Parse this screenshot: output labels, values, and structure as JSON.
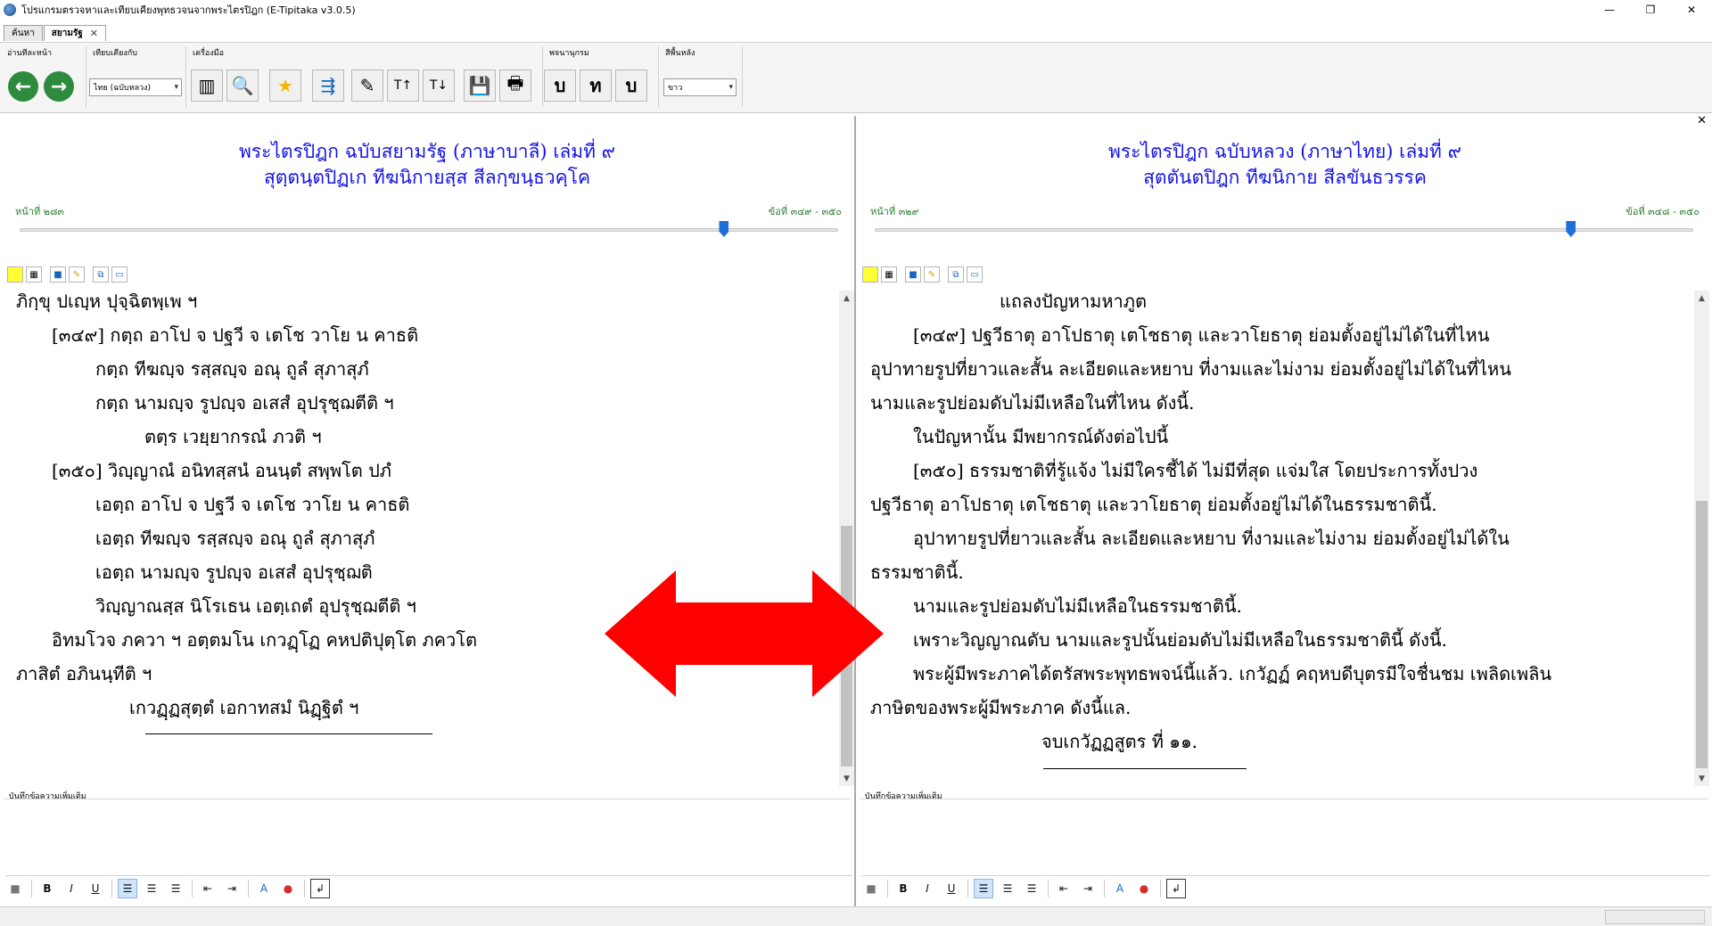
{
  "window": {
    "title": "โปรแกรมตรวจหาและเทียบเคียงพุทธวจนจากพระไตรปิฎก (E-Tipitaka v3.0.5)",
    "minimize": "—",
    "maximize": "❐",
    "close": "✕"
  },
  "tabs": [
    {
      "label": "ค้นหา",
      "active": false
    },
    {
      "label": "สยามรัฐ",
      "active": true,
      "close": "✕"
    }
  ],
  "ribbon": {
    "read_group": "อ่านทีละหน้า",
    "compare_group": "เทียบเคียงกับ",
    "compare_value": "ไทย (ฉบับหลวง)",
    "tools_group": "เครื่องมือ",
    "dict_group": "พจนานุกรม",
    "bg_group": "สีพื้นหลัง",
    "bg_value": "ขาว",
    "dict_buttons": [
      "บ",
      "ท",
      "บ"
    ],
    "colors": {
      "nav_green": "#2e8b3d",
      "star": "#f5b800",
      "save": "#1565c0"
    }
  },
  "left": {
    "heading1": "พระไตรปิฎก ฉบับสยามรัฐ (ภาษาบาลี) เล่มที่ ๙",
    "heading2": "สุตฺตนฺตปิฏเก ทีฆนิกายสฺส สีลกฺขนฺธวคฺโค",
    "page_no": "หน้าที่ ๒๘๓",
    "item_no": "ข้อที่ ๓๔๙ - ๓๕๐",
    "slider_position": 0.86,
    "lines": [
      "ภิกฺขุ ปเญฺห ปุจฺฉิตพฺเพ ฯ",
      "[๓๔๙] กตฺถ อาโป จ ปฐวี จ    เตโช วาโย น คาธติ",
      "กตฺถ ทีฆญฺจ รสฺสญฺจ      อณุ ถูลํ สุภาสุภํ",
      "กตฺถ นามญฺจ รูปญฺจ      อเสสํ อุปรุชฺฌตีติ ฯ",
      "ตตฺร เวยฺยากรณํ ภวติ ฯ",
      "[๓๕๐] วิญฺญาณํ อนิทสฺสนํ        อนนฺตํ สพฺพโต ปภํ",
      "เอตฺถ อาโป จ ปฐวี จ  เตโช วาโย น คาธติ",
      "เอตฺถ ทีฆญฺจ รสฺสญฺจ     อณุ ถูลํ สุภาสุภํ",
      "เอตฺถ นามญฺจ รูปญฺจ     อเสสํ อุปรุชฺฌติ",
      "วิญฺญาณสฺส นิโรเธน      เอตฺเถตํ อุปรุชฺฌตีติ ฯ",
      "อิทมโวจ    ภควา    ฯ   อตฺตมโน   เกวฏฺโฏ   คหปติปุตฺโต   ภควโต",
      "ภาสิตํ อภินนฺทีติ ฯ",
      "เกวฏฺฏสุตฺตํ เอกาทสมํ นิฏฺฐิตํ ฯ"
    ],
    "notes_label": "บันทึกข้อความเพิ่มเติม"
  },
  "right": {
    "heading1": "พระไตรปิฎก ฉบับหลวง (ภาษาไทย) เล่มที่ ๙",
    "heading2": "สุตตันตปิฎก ทีฆนิกาย สีลขันธวรรค",
    "page_no": "หน้าที่ ๓๒๙",
    "item_no": "ข้อที่ ๓๔๘ - ๓๕๐",
    "slider_position": 0.85,
    "lines": [
      "แถลงปัญหามหาภูต",
      "[๓๔๙] ปฐวีธาตุ อาโปธาตุ เตโชธาตุ และวาโยธาตุ ย่อมตั้งอยู่ไม่ได้ในที่ไหน",
      "อุปาทายรูปที่ยาวและสั้น ละเอียดและหยาบ ที่งามและไม่งาม ย่อมตั้งอยู่ไม่ได้ในที่ไหน",
      "นามและรูปย่อมดับไม่มีเหลือในที่ไหน ดังนี้.",
      "ในปัญหานั้น มีพยากรณ์ดังต่อไปนี้",
      "[๓๕๐] ธรรมชาติที่รู้แจ้ง ไม่มีใครชี้ได้ ไม่มีที่สุด แจ่มใส โดยประการทั้งปวง",
      "ปฐวีธาตุ อาโปธาตุ เตโชธาตุ และวาโยธาตุ ย่อมตั้งอยู่ไม่ได้ในธรรมชาตินี้.",
      "อุปาทายรูปที่ยาวและสั้น ละเอียดและหยาบ ที่งามและไม่งาม ย่อมตั้งอยู่ไม่ได้ใน",
      "ธรรมชาตินี้.",
      "นามและรูปย่อมดับไม่มีเหลือในธรรมชาตินี้.",
      "เพราะวิญญาณดับ นามและรูปนั้นย่อมดับไม่มีเหลือในธรรมชาตินี้ ดังนี้.",
      "พระผู้มีพระภาคได้ตรัสพระพุทธพจน์นี้แล้ว. เกวัฏฏ์ คฤหบดีบุตรมีใจชื่นชม เพลิดเพลิน",
      "ภาษิตของพระผู้มีพระภาค ดังนี้แล.",
      "จบเกวัฏฏสูตร ที่ ๑๑."
    ],
    "notes_label": "บันทึกข้อความเพิ่มเติม"
  },
  "format_bar": {
    "bold": "B",
    "italic": "I",
    "underline": "U",
    "font_color": "A"
  },
  "overlay": {
    "arrow_color": "#ff0000"
  }
}
